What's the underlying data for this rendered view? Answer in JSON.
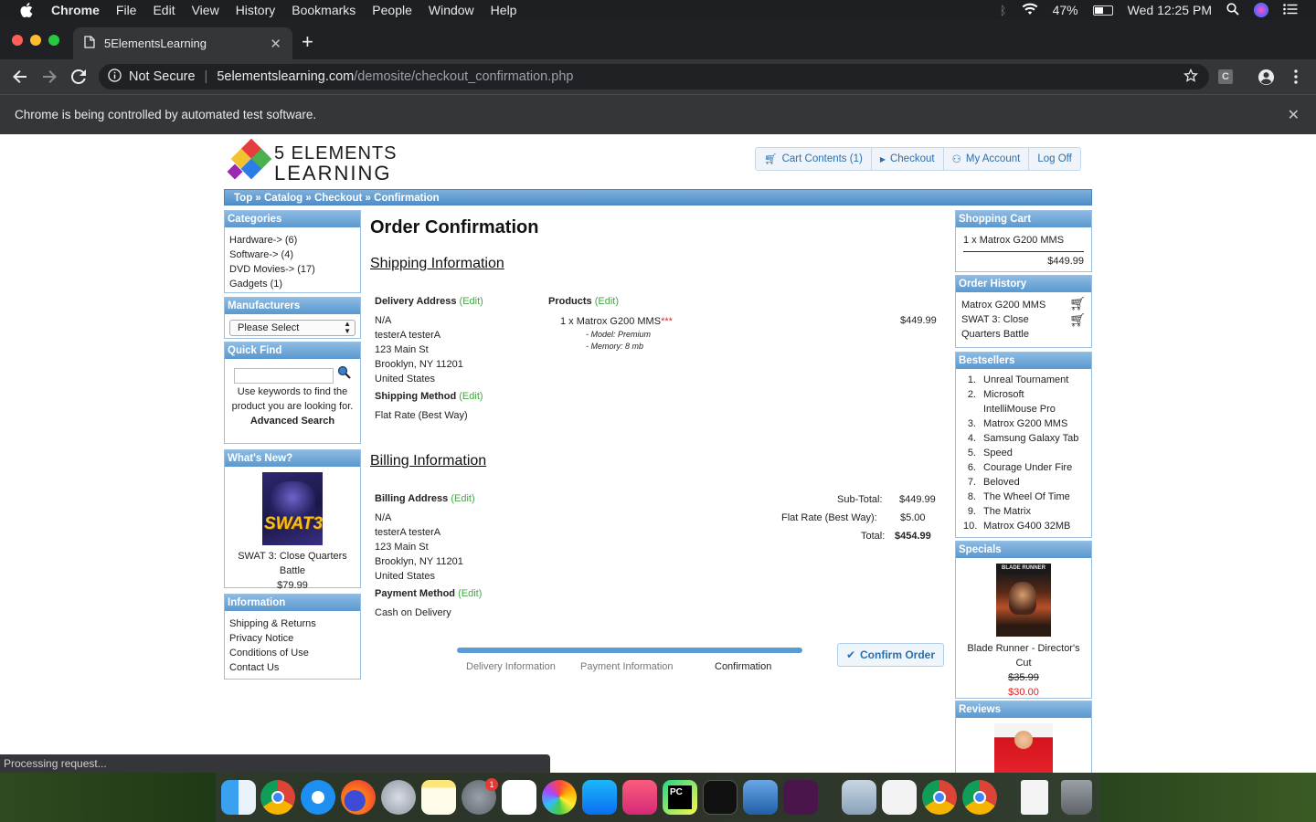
{
  "menubar": {
    "app": "Chrome",
    "items": [
      "File",
      "Edit",
      "View",
      "History",
      "Bookmarks",
      "People",
      "Window",
      "Help"
    ],
    "battery": "47%",
    "clock": "Wed 12:25 PM"
  },
  "browser": {
    "tab_title": "5ElementsLearning",
    "security_label": "Not Secure",
    "url_host": "5elementslearning.com",
    "url_path": "/demosite/checkout_confirmation.php",
    "infobar_text": "Chrome is being controlled by automated test software.",
    "status_text": "Processing request..."
  },
  "site": {
    "logo_line1": "5 ELEMENTS",
    "logo_line2": "LEARNING",
    "topnav": [
      "Cart Contents (1)",
      "Checkout",
      "My Account",
      "Log Off"
    ],
    "breadcrumb": "Top » Catalog » Checkout » Confirmation"
  },
  "left": {
    "categories_title": "Categories",
    "categories": [
      "Hardware-> (6)",
      "Software-> (4)",
      "DVD Movies-> (17)",
      "Gadgets (1)"
    ],
    "manufacturers_title": "Manufacturers",
    "manufacturers_select": "Please Select",
    "quickfind_title": "Quick Find",
    "quickfind_help": "Use keywords to find the product you are looking for.",
    "advanced_search": "Advanced Search",
    "whatsnew_title": "What's New?",
    "whatsnew_product": "SWAT 3: Close Quarters Battle",
    "whatsnew_price": "$79.99",
    "information_title": "Information",
    "information": [
      "Shipping & Returns",
      "Privacy Notice",
      "Conditions of Use",
      "Contact Us"
    ]
  },
  "main": {
    "title": "Order Confirmation",
    "shipping_title": "Shipping Information",
    "delivery_address_label": "Delivery Address",
    "edit": "(Edit)",
    "delivery_address": [
      "N/A",
      "testerA testerA",
      "123 Main St",
      "Brooklyn, NY 11201",
      "United States"
    ],
    "shipping_method_label": "Shipping Method",
    "shipping_method": "Flat Rate (Best Way)",
    "products_label": "Products",
    "product_qty": "1 x",
    "product_name": "Matrox G200 MMS",
    "stock_marker": "***",
    "product_price": "$449.99",
    "product_attrs": [
      "- Model: Premium",
      "- Memory: 8 mb"
    ],
    "billing_title": "Billing Information",
    "billing_address_label": "Billing Address",
    "billing_address": [
      "N/A",
      "testerA testerA",
      "123 Main St",
      "Brooklyn, NY 11201",
      "United States"
    ],
    "payment_method_label": "Payment Method",
    "payment_method": "Cash on Delivery",
    "subtotal_label": "Sub-Total:",
    "subtotal": "$449.99",
    "flatrate_label": "Flat Rate (Best Way):",
    "flatrate": "$5.00",
    "total_label": "Total:",
    "total": "$454.99",
    "steps": [
      "Delivery Information",
      "Payment Information",
      "Confirmation"
    ],
    "confirm_button": "Confirm Order"
  },
  "right": {
    "cart_title": "Shopping Cart",
    "cart_item": "1 x Matrox G200 MMS",
    "cart_total": "$449.99",
    "history_title": "Order History",
    "history": [
      "Matrox G200 MMS",
      "SWAT 3: Close Quarters Battle"
    ],
    "bestsellers_title": "Bestsellers",
    "bestsellers": [
      "Unreal Tournament",
      "Microsoft IntelliMouse Pro",
      "Matrox G200 MMS",
      "Samsung Galaxy Tab",
      "Speed",
      "Courage Under Fire",
      "Beloved",
      "The Wheel Of Time",
      "The Matrix",
      "Matrox G400 32MB"
    ],
    "specials_title": "Specials",
    "specials_product": "Blade Runner - Director's Cut",
    "specials_old_price": "$35.99",
    "specials_new_price": "$30.00",
    "reviews_title": "Reviews"
  },
  "dock": {
    "settings_badge": "1"
  }
}
